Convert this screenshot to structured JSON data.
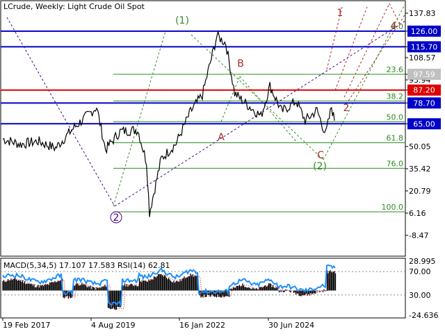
{
  "header": {
    "symbol_text": "LCrude, Weekly:  Light Crude Oil Spot"
  },
  "colors": {
    "price": "#000000",
    "blue_level": "#0000c8",
    "red_level": "#dd0000",
    "fib": "#2e8b22",
    "wave_green": "#2e8b22",
    "wave_red": "#a52a2a",
    "wave_purple": "#4b0082",
    "macd_hist": "#000000",
    "rsi_line": "#1e90ff",
    "signal_line": "#dd0000",
    "gray_tag": "#c0c0c0"
  },
  "chart_data": [
    {
      "type": "line",
      "title": "LCrude, Weekly:  Light Crude Oil Spot",
      "ylim": [
        -20.0,
        140.0
      ],
      "y_ticks": [
        "137.83",
        "126.00",
        "115.70",
        "108.57",
        "97.59",
        "93.94",
        "87.20",
        "78.70",
        "65.00",
        "50.05",
        "35.42",
        "20.79",
        "6.16",
        "-8.47"
      ],
      "x_tick_labels": [
        "19 Feb 2017",
        "4 Aug 2019",
        "16 Jan 2022",
        "30 Jun 2024"
      ],
      "grid": false,
      "series": [
        {
          "x_dates": [
            "2016-02",
            "2016-08",
            "2017-02",
            "2017-08",
            "2018-02",
            "2018-10",
            "2019-01",
            "2019-06",
            "2019-12",
            "2020-03",
            "2020-04",
            "2020-08",
            "2021-01",
            "2021-06",
            "2021-10",
            "2022-03",
            "2022-06",
            "2022-09",
            "2023-01",
            "2023-06",
            "2023-09",
            "2024-01",
            "2024-06",
            "2024-09",
            "2025-01",
            "2025-04",
            "2025-06",
            "2025-07"
          ],
          "values": [
            55.0,
            51.5,
            53.5,
            49.0,
            62.0,
            76.0,
            48.0,
            60.0,
            61.0,
            40.0,
            6.5,
            42.0,
            52.0,
            73.0,
            84.0,
            123.0,
            118.0,
            85.0,
            78.0,
            70.0,
            90.0,
            73.0,
            80.0,
            67.0,
            74.0,
            58.0,
            76.0,
            67.0
          ]
        }
      ],
      "horizontal_levels": [
        {
          "value": 126.0,
          "label": "126.00",
          "color": "#0000c8"
        },
        {
          "value": 115.7,
          "label": "115.70",
          "color": "#0000c8"
        },
        {
          "value": 87.2,
          "label": "87.20",
          "color": "#dd0000"
        },
        {
          "value": 78.7,
          "label": "78.70",
          "color": "#0000c8"
        },
        {
          "value": 65.0,
          "label": "65.00",
          "color": "#0000c8"
        }
      ],
      "gray_tags": [
        {
          "value": 97.59,
          "label": "97.59"
        }
      ],
      "fibonacci_levels": [
        {
          "ratio": "0.0",
          "value": 126.0
        },
        {
          "ratio": "23.6",
          "value": 97.59
        },
        {
          "ratio": "38.2",
          "value": 80.0
        },
        {
          "ratio": "50.0",
          "value": 66.3
        },
        {
          "ratio": "61.8",
          "value": 52.5
        },
        {
          "ratio": "76.0",
          "value": 35.7
        },
        {
          "ratio": "100.0",
          "value": 7.0
        }
      ],
      "wave_labels": [
        {
          "text": "(1)",
          "style": "green"
        },
        {
          "text": "A",
          "style": "red"
        },
        {
          "text": "B",
          "style": "red"
        },
        {
          "text": "C",
          "style": "red"
        },
        {
          "text": "(2)",
          "style": "green"
        },
        {
          "text": "1",
          "style": "red"
        },
        {
          "text": "2",
          "style": "red"
        },
        {
          "text": "4",
          "style": "red"
        },
        {
          "text": "2",
          "style": "purple-circle"
        }
      ]
    },
    {
      "type": "bar",
      "title": "MACD(5,34,5) 17.107 17.583 RSI(14) 62.81",
      "ylim": [
        -24.636,
        28.995
      ],
      "y_ticks": [
        "28.995",
        "70.00",
        "30.00",
        "-24.636"
      ],
      "series": [
        {
          "name": "MACD",
          "value": 17.107
        },
        {
          "name": "Signal",
          "value": 17.583
        },
        {
          "name": "RSI(14)",
          "value": 62.81
        }
      ]
    }
  ]
}
